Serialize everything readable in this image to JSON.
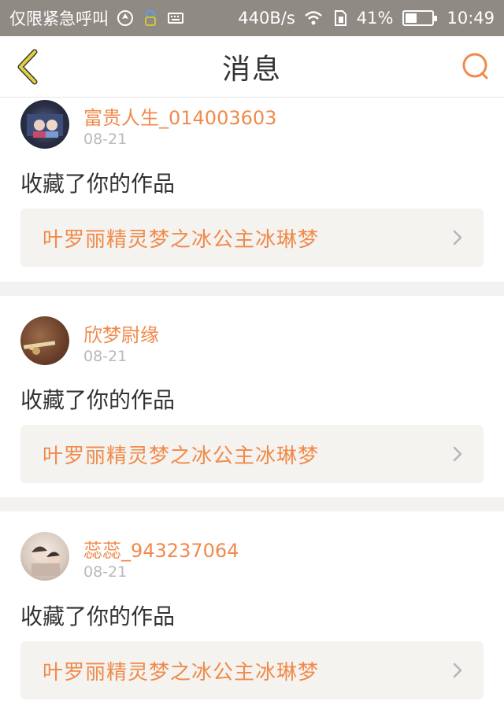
{
  "status_bar": {
    "carrier": "仅限紧急呼叫",
    "speed": "440B/s",
    "battery_percent": "41%",
    "battery_level": 0.41,
    "time": "10:49"
  },
  "header": {
    "title": "消息"
  },
  "messages": [
    {
      "username": "富贵人生_014003603",
      "date": "08-21",
      "action": "收藏了你的作品",
      "work_title": "叶罗丽精灵梦之冰公主冰琳梦"
    },
    {
      "username": "欣梦尉缘",
      "date": "08-21",
      "action": "收藏了你的作品",
      "work_title": "叶罗丽精灵梦之冰公主冰琳梦"
    },
    {
      "username": "蕊蕊_943237064",
      "date": "08-21",
      "action": "收藏了你的作品",
      "work_title": "叶罗丽精灵梦之冰公主冰琳梦"
    }
  ],
  "colors": {
    "accent": "#f08a4b",
    "back_icon": "#e2cf3d",
    "text_dark": "#333333",
    "date_gray": "#b9b9b9",
    "status_bar_bg": "#8f8a84"
  }
}
